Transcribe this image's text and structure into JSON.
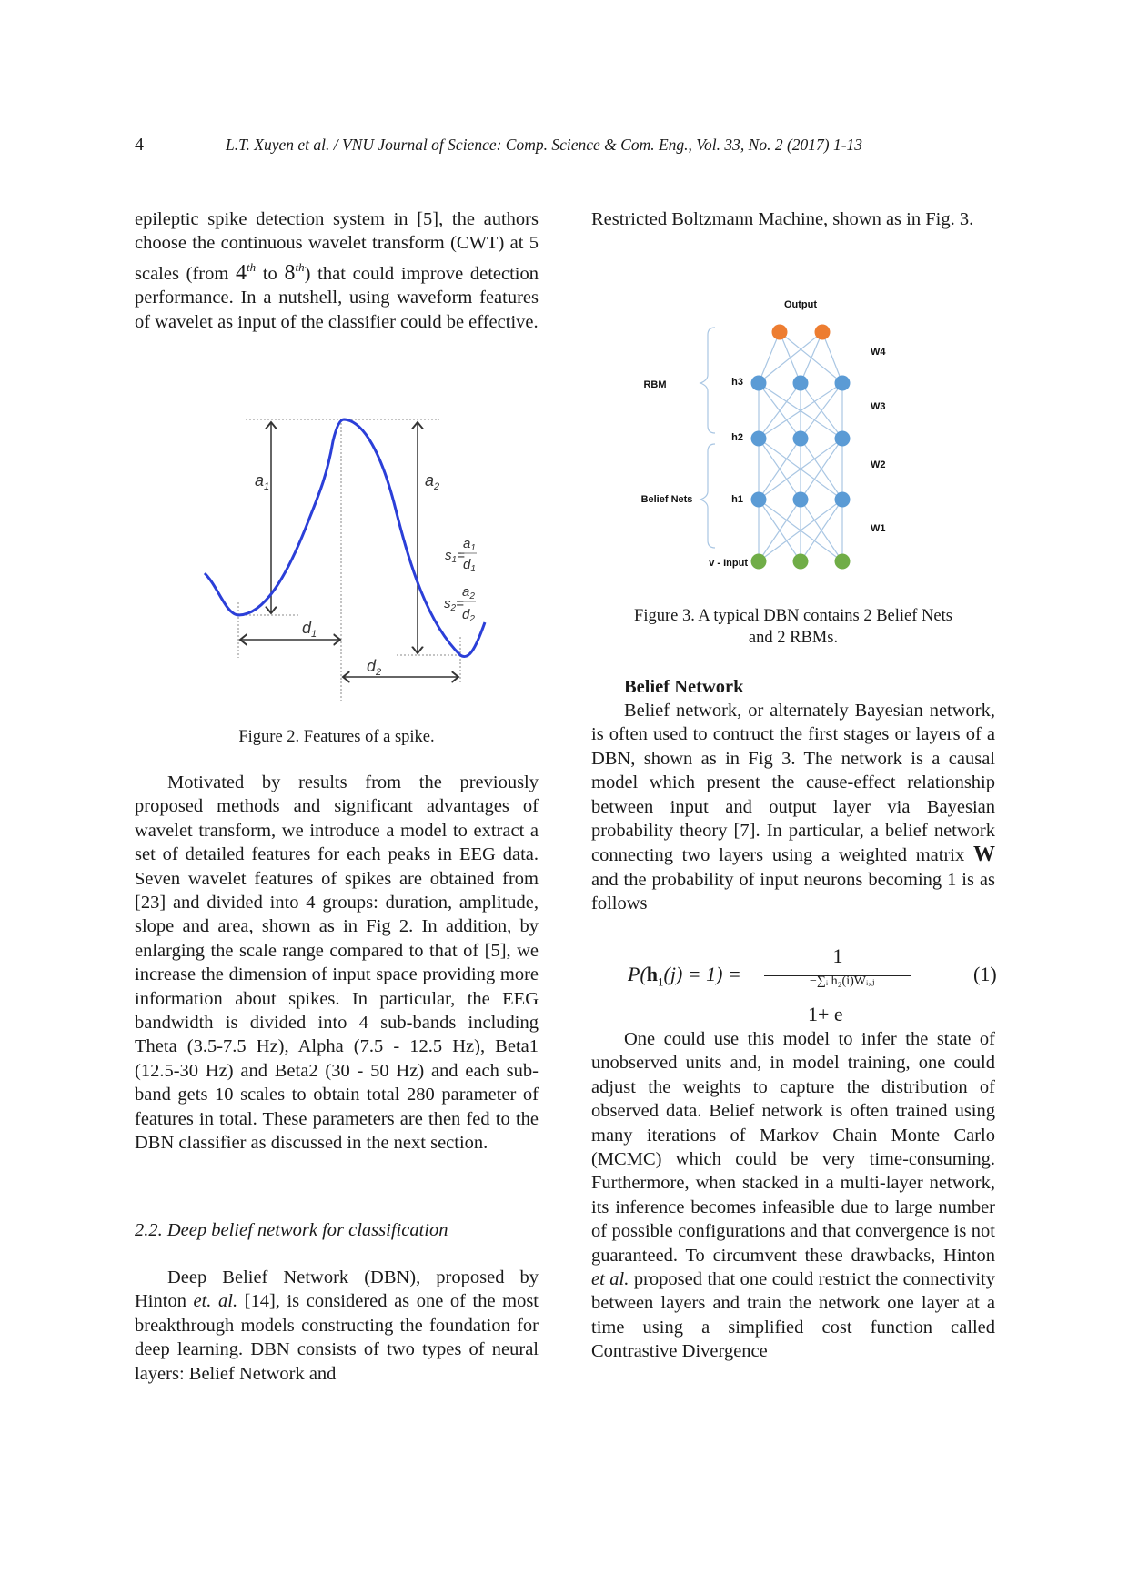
{
  "header": {
    "page_number": "4",
    "running_title": "L.T. Xuyen et al. / VNU Journal of Science: Comp. Science & Com. Eng., Vol. 33, No. 2 (2017) 1-13"
  },
  "left_column": {
    "p1_a": "epileptic spike detection system in [5], the authors choose the continuous wavelet transform (CWT) at 5 scales (from ",
    "p1_b": "4",
    "p1_b_sup": "th",
    "p1_c": " to ",
    "p1_d": "8",
    "p1_d_sup": "th",
    "p1_e": ") that could improve detection performance. In a nutshell, using waveform features of wavelet as input of the classifier could be effective.",
    "figure2": {
      "labels": {
        "a1": "a",
        "a1_sub": "1",
        "a2": "a",
        "a2_sub": "2",
        "d1": "d",
        "d1_sub": "1",
        "d2": "d",
        "d2_sub": "2",
        "s1": "s",
        "s1_sub": "1",
        "s2": "s",
        "s2_sub": "2"
      },
      "caption": "Figure  2. Features of a spike."
    },
    "p2": "Motivated by results from the previously proposed methods and significant advantages of wavelet transform, we introduce a model to extract a set of detailed features for each peaks in EEG data. Seven wavelet features of spikes are obtained from [23] and divided into 4 groups: duration, amplitude, slope and area, shown as in Fig 2. In addition, by enlarging the scale range compared to that of [5], we increase the dimension of input space providing more information about spikes. In particular, the EEG bandwidth is divided into 4 sub-bands including Theta (3.5-7.5 Hz), Alpha (7.5 - 12.5 Hz), Beta1 (12.5-30 Hz) and Beta2 (30 - 50 Hz) and each sub-band gets 10 scales to obtain total 280 parameter of features in total. These parameters are then fed to the DBN classifier as discussed in the next section.",
    "section_heading": "2.2. Deep belief network for classification",
    "p3_a": "Deep Belief Network (DBN), proposed by Hinton ",
    "p3_b": "et. al.",
    "p3_c": " [14], is considered as one of the most breakthrough models constructing the foundation for deep learning. DBN consists of two types of neural layers: Belief Network and"
  },
  "right_column": {
    "p1": "Restricted Boltzmann Machine, shown as in Fig. 3.",
    "figure3": {
      "title": "Output",
      "group_rbm": "RBM",
      "group_belief": "Belief Nets",
      "layers": [
        "h3",
        "h2",
        "h1",
        "v - Input"
      ],
      "weights": [
        "W4",
        "W3",
        "W2",
        "W1"
      ],
      "colors": {
        "output": "#ED7D31",
        "hidden": "#5B9BD5",
        "input": "#70AD47",
        "edge": "#A9C6E3"
      },
      "caption_line1": "Figure  3. A typical DBN contains 2 Belief Nets",
      "caption_line2": "and 2 RBMs."
    },
    "subheading": "Belief Network",
    "p2_a": "Belief network, or alternately Bayesian network, is often used to contruct the first stages or layers of a DBN, shown as in Fig 3. The network is a causal model which present the cause-effect relationship between input and output layer via Bayesian probability theory [7]. In particular, a belief network connecting two layers using a weighted matrix ",
    "p2_w": "W",
    "p2_b": " and the probability of input neurons becoming 1 is as follows",
    "equation": {
      "lhs": "P(h₁(j) = 1) =",
      "numerator": "1",
      "denominator": "1+ e",
      "exponent": "−∑ᵢ h₂(i)Wᵢ,ⱼ",
      "number": "(1)"
    },
    "p3": "One could use this model to infer the state of unobserved units and, in model training, one could adjust the weights to capture the distribution of observed data. Belief network is often trained using many iterations of Markov Chain Monte Carlo (MCMC) which could be very time-consuming. Furthermore, when stacked in a multi-layer network, its inference becomes infeasible due to large number of possible configurations and that convergence is not guaranteed. To circumvent these drawbacks, Hinton ",
    "p3_it": "et al.",
    "p3_b": " proposed that one could restrict the connectivity between layers and train the network one layer at a time using a simplified cost function called Contrastive Divergence"
  }
}
